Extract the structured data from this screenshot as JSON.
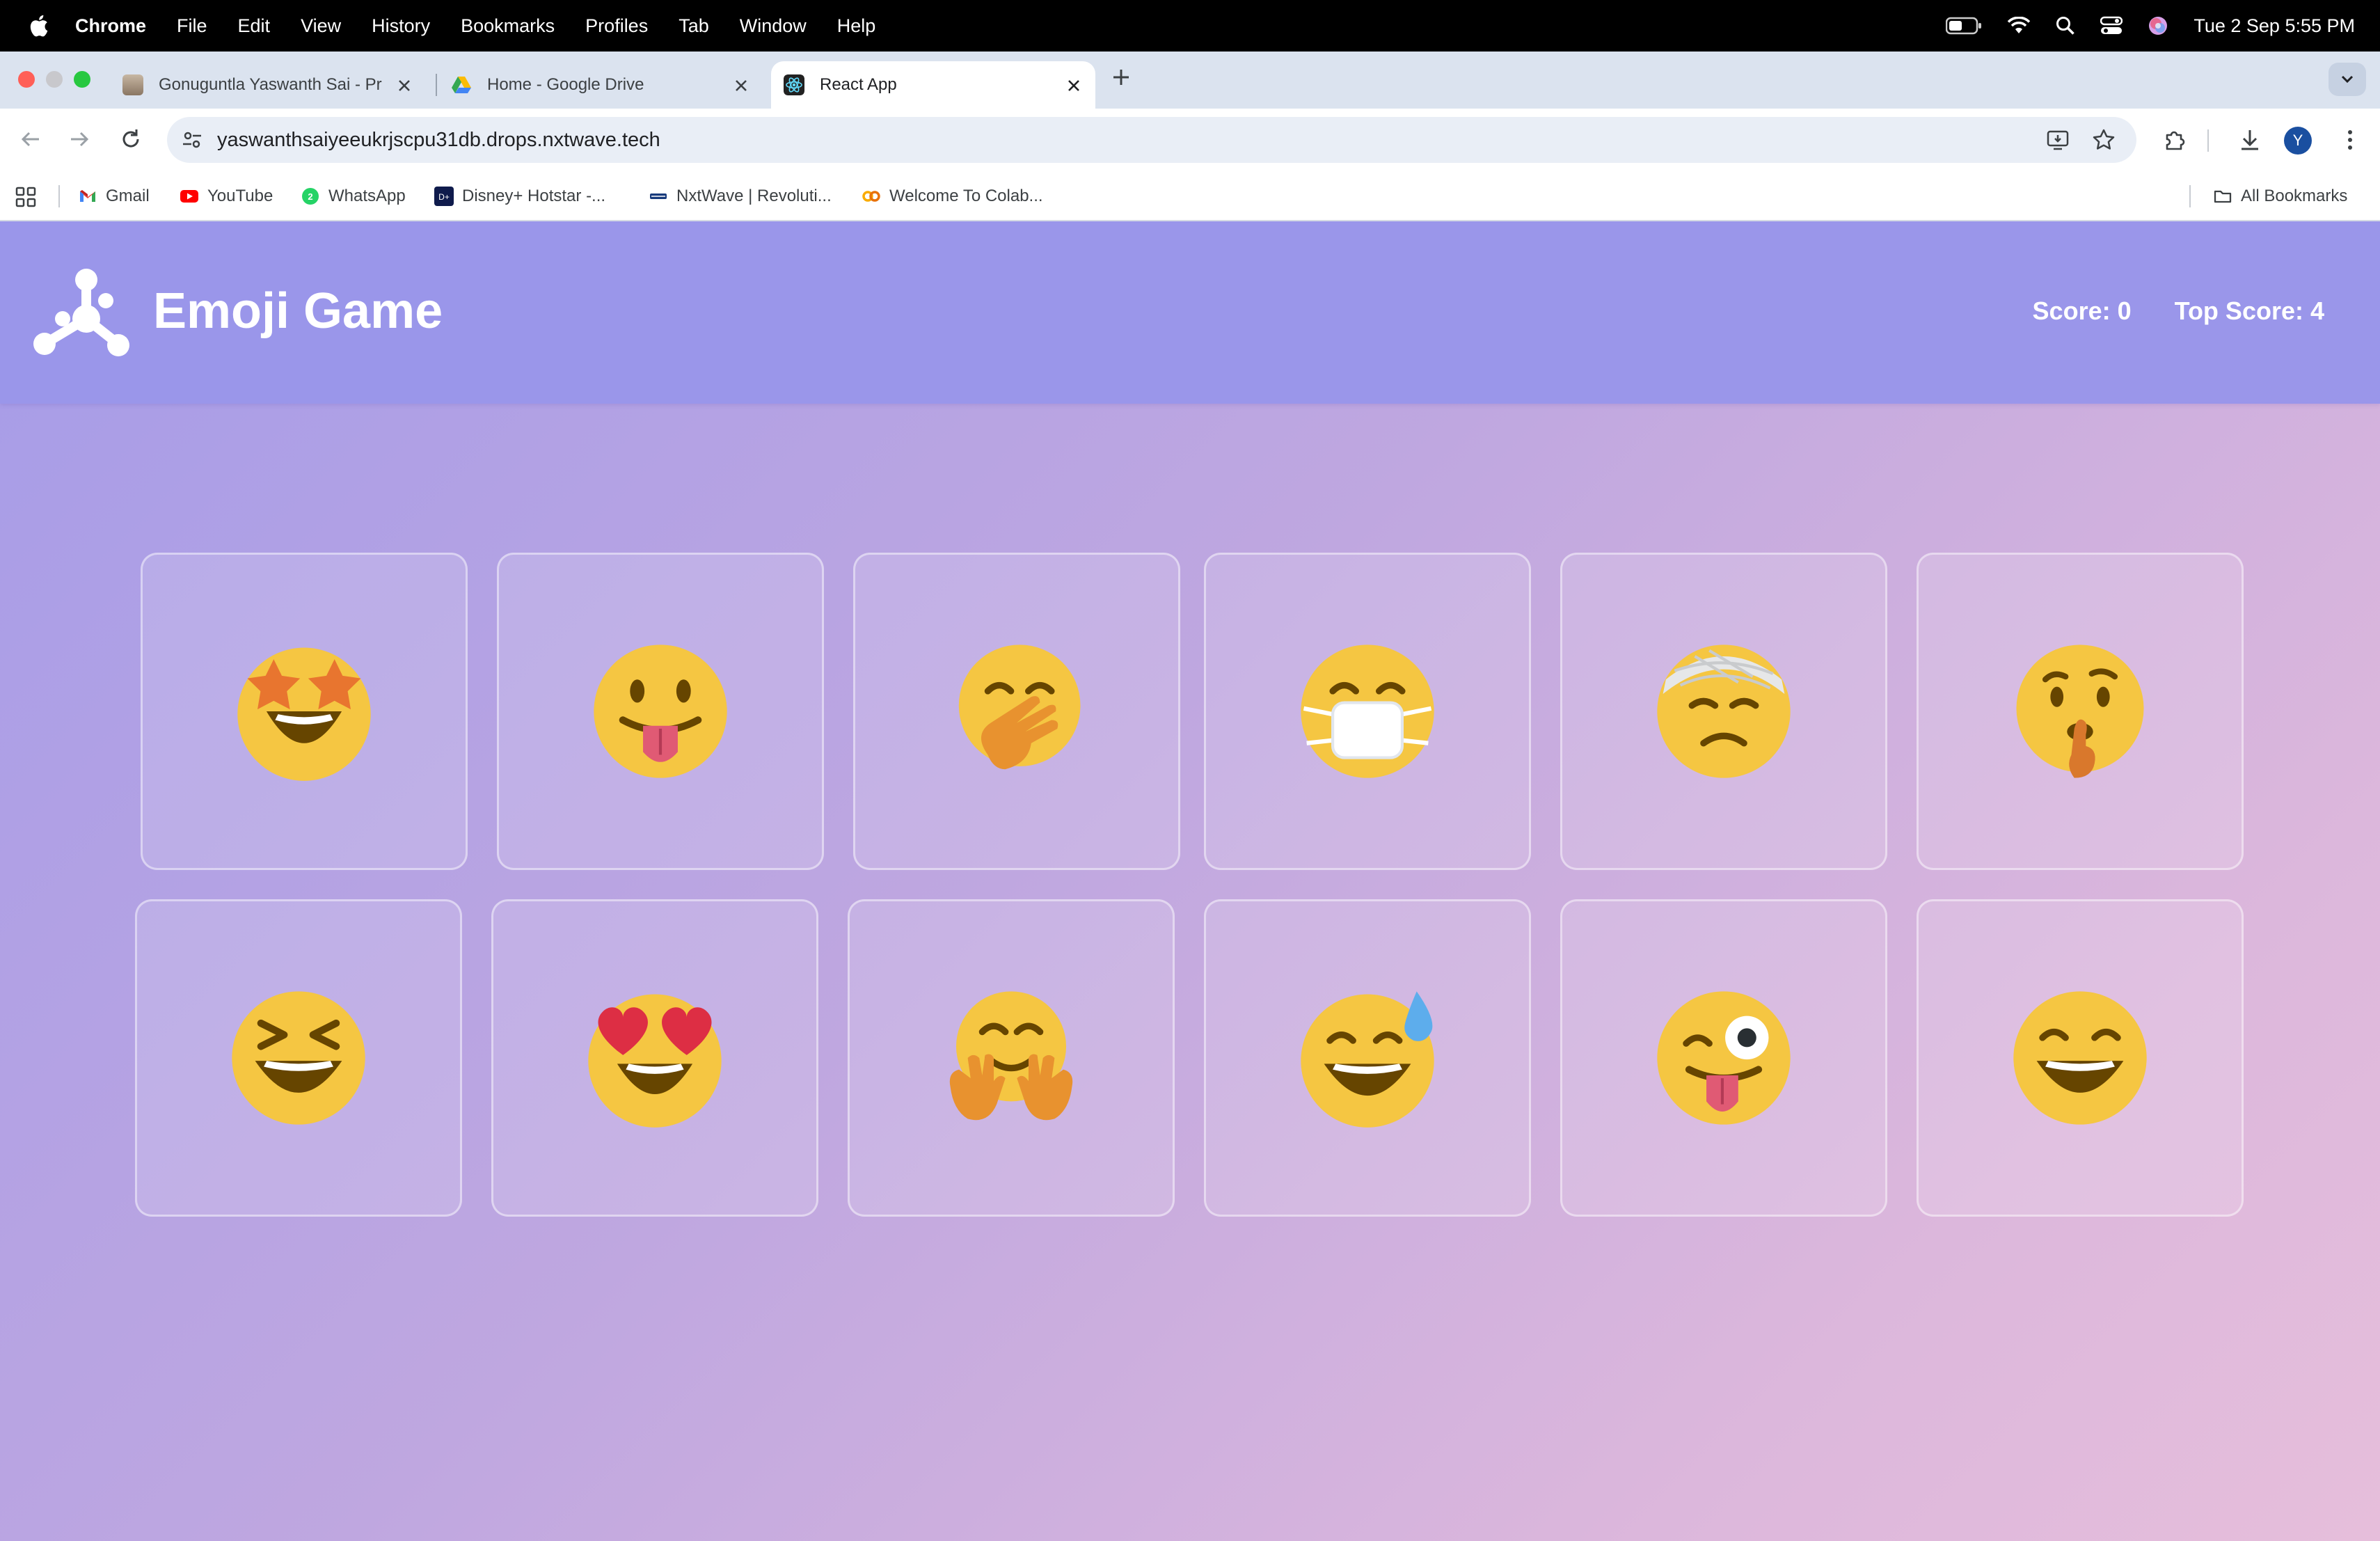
{
  "menubar": {
    "app": "Chrome",
    "items": [
      "File",
      "Edit",
      "View",
      "History",
      "Bookmarks",
      "Profiles",
      "Tab",
      "Window",
      "Help"
    ],
    "clock": "Tue 2 Sep  5:55 PM"
  },
  "tabs": [
    {
      "title": "Gonuguntla Yaswanth Sai - Pr",
      "favicon": "profile-photo-icon"
    },
    {
      "title": "Home - Google Drive",
      "favicon": "google-drive-icon"
    },
    {
      "title": "React App",
      "favicon": "react-icon",
      "active": true
    }
  ],
  "toolbar": {
    "url": "yaswanthsaiyeeukrjscpu31db.drops.nxtwave.tech",
    "avatar_letter": "Y"
  },
  "bookmarks": [
    {
      "label": "Gmail",
      "icon": "gmail-icon"
    },
    {
      "label": "YouTube",
      "icon": "youtube-icon"
    },
    {
      "label": "WhatsApp",
      "icon": "whatsapp-icon"
    },
    {
      "label": "Disney+ Hotstar -...",
      "icon": "hotstar-icon"
    },
    {
      "label": "NxtWave | Revoluti...",
      "icon": "nxtwave-icon"
    },
    {
      "label": "Welcome To Colab...",
      "icon": "colab-icon"
    }
  ],
  "all_bookmarks": "All Bookmarks",
  "game": {
    "title": "Emoji Game",
    "score": "Score: 0",
    "top_score": "Top Score: 4",
    "emojis": [
      {
        "name": "star-struck-face"
      },
      {
        "name": "tongue-out-face"
      },
      {
        "name": "face-with-hand-over-mouth"
      },
      {
        "name": "face-with-medical-mask"
      },
      {
        "name": "face-with-head-bandage"
      },
      {
        "name": "shushing-face"
      },
      {
        "name": "grinning-squinting-face"
      },
      {
        "name": "smiling-face-with-heart-eyes"
      },
      {
        "name": "hugging-face"
      },
      {
        "name": "grinning-face-with-sweat"
      },
      {
        "name": "winking-face-with-tongue"
      },
      {
        "name": "grinning-face-with-smiling-eyes"
      }
    ]
  },
  "colors": {
    "header": "#9a96ea",
    "emoji_yellow": "#f5c642",
    "emoji_dark": "#664500",
    "emoji_orange": "#e8752f"
  }
}
